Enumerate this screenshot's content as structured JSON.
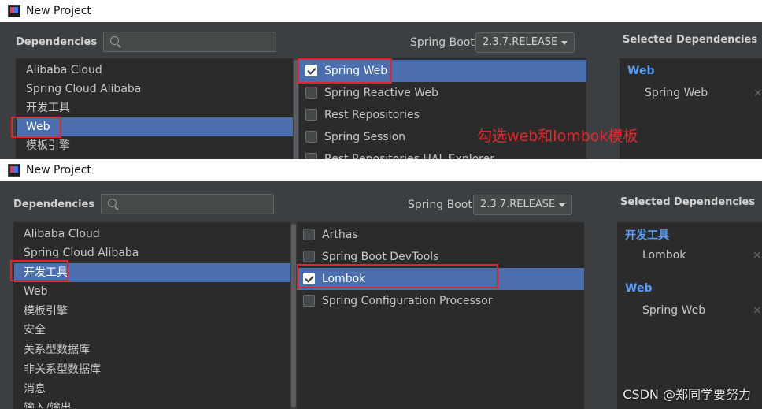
{
  "top": {
    "window_title": "New Project",
    "dependencies_label": "Dependencies",
    "spring_boot_label": "Spring Boot",
    "spring_boot_version": "2.3.7.RELEASE",
    "selected_deps_title": "Selected Dependencies",
    "categories": [
      "Alibaba Cloud",
      "Spring Cloud Alibaba",
      "开发工具",
      "Web",
      "模板引擎"
    ],
    "dependencies": [
      {
        "label": "Spring Web",
        "checked": true
      },
      {
        "label": "Spring Reactive Web",
        "checked": false
      },
      {
        "label": "Rest Repositories",
        "checked": false
      },
      {
        "label": "Spring Session",
        "checked": false
      },
      {
        "label": "Rest Repositories HAL Explorer",
        "checked": false
      }
    ],
    "selected_group": "Web",
    "selected_entry": "Spring Web"
  },
  "bottom": {
    "window_title": "New Project",
    "dependencies_label": "Dependencies",
    "spring_boot_label": "Spring Boot",
    "spring_boot_version": "2.3.7.RELEASE",
    "selected_deps_title": "Selected Dependencies",
    "categories": [
      "Alibaba Cloud",
      "Spring Cloud Alibaba",
      "开发工具",
      "Web",
      "模板引擎",
      "安全",
      "关系型数据库",
      "非关系型数据库",
      "消息",
      "输入/输出"
    ],
    "dependencies": [
      {
        "label": "Arthas",
        "checked": false
      },
      {
        "label": "Spring Boot DevTools",
        "checked": false
      },
      {
        "label": "Lombok",
        "checked": true
      },
      {
        "label": "Spring Configuration Processor",
        "checked": false
      }
    ],
    "selected_groups": [
      {
        "group": "开发工具",
        "entry": "Lombok"
      },
      {
        "group": "Web",
        "entry": "Spring Web"
      }
    ]
  },
  "annotation": "勾选web和lombok模板",
  "watermark": "CSDN @郑同学要努力",
  "colors": {
    "dark_bg": "#3c3f41",
    "list_bg": "#2b2b2b",
    "selection": "#4b6eaf",
    "group_text": "#589df6",
    "highlight_red": "#e0262b"
  }
}
